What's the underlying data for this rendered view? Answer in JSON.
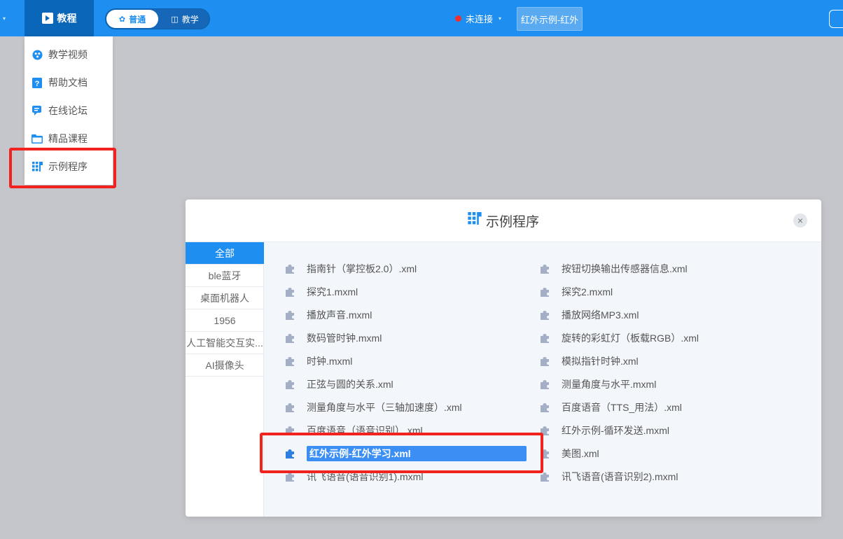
{
  "topbar": {
    "left_fragment": "-",
    "tutorial_label": "教程",
    "mode_normal": "普通",
    "mode_teach": "教学",
    "connection_status": "未连接",
    "current_file": "红外示例-红外"
  },
  "menu": {
    "items": [
      {
        "label": "教学视频",
        "icon": "video-icon"
      },
      {
        "label": "帮助文档",
        "icon": "help-doc-icon"
      },
      {
        "label": "在线论坛",
        "icon": "forum-icon"
      },
      {
        "label": "精品课程",
        "icon": "folder-icon"
      },
      {
        "label": "示例程序",
        "icon": "sample-program-icon"
      }
    ]
  },
  "modal": {
    "title": "示例程序",
    "categories": [
      "全部",
      "ble蓝牙",
      "桌面机器人",
      "1956",
      "人工智能交互实...",
      "AI摄像头"
    ],
    "files_left": [
      "指南针（掌控板2.0）.xml",
      "探究1.mxml",
      "播放声音.mxml",
      "数码管时钟.mxml",
      "时钟.mxml",
      "正弦与圆的关系.xml",
      "测量角度与水平（三轴加速度）.xml",
      "百度语音（语音识别）.xml",
      "红外示例-红外学习.xml",
      "讯飞语音(语音识别1).mxml"
    ],
    "files_right": [
      "按钮切换输出传感器信息.xml",
      "探究2.mxml",
      "播放网络MP3.xml",
      "旋转的彩虹灯（板载RGB）.xml",
      "模拟指针时钟.xml",
      "测量角度与水平.mxml",
      "百度语音（TTS_用法）.xml",
      "红外示例-循环发送.mxml",
      "美图.xml",
      "讯飞语音(语音识别2).mxml"
    ],
    "selected_file": "红外示例-红外学习.xml"
  },
  "colors": {
    "topbar": "#1e8ff0",
    "accent": "#1e8ff0",
    "highlight_box": "#f2231e",
    "selected": "#3a8ef4"
  }
}
